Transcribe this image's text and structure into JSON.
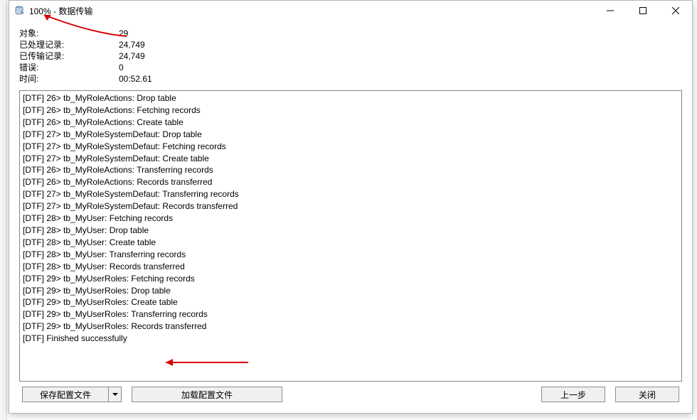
{
  "window": {
    "title": "100% - 数据传输"
  },
  "stats": {
    "objects_label": "对象:",
    "objects_value": "29",
    "processed_label": "已处理记录:",
    "processed_value": "24,749",
    "transferred_label": "已传输记录:",
    "transferred_value": "24,749",
    "errors_label": "错误:",
    "errors_value": "0",
    "time_label": "时间:",
    "time_value": "00:52.61"
  },
  "log": [
    "[DTF] 26> tb_MyRoleActions: Drop table",
    "[DTF] 26> tb_MyRoleActions: Fetching records",
    "[DTF] 26> tb_MyRoleActions: Create table",
    "[DTF] 27> tb_MyRoleSystemDefaut: Drop table",
    "[DTF] 27> tb_MyRoleSystemDefaut: Fetching records",
    "[DTF] 27> tb_MyRoleSystemDefaut: Create table",
    "[DTF] 26> tb_MyRoleActions: Transferring records",
    "[DTF] 26> tb_MyRoleActions: Records transferred",
    "[DTF] 27> tb_MyRoleSystemDefaut: Transferring records",
    "[DTF] 27> tb_MyRoleSystemDefaut: Records transferred",
    "[DTF] 28> tb_MyUser: Fetching records",
    "[DTF] 28> tb_MyUser: Drop table",
    "[DTF] 28> tb_MyUser: Create table",
    "[DTF] 28> tb_MyUser: Transferring records",
    "[DTF] 28> tb_MyUser: Records transferred",
    "[DTF] 29> tb_MyUserRoles: Fetching records",
    "[DTF] 29> tb_MyUserRoles: Drop table",
    "[DTF] 29> tb_MyUserRoles: Create table",
    "[DTF] 29> tb_MyUserRoles: Transferring records",
    "[DTF] 29> tb_MyUserRoles: Records transferred",
    "[DTF] Finished successfully"
  ],
  "buttons": {
    "save": "保存配置文件",
    "load": "加载配置文件",
    "prev": "上一步",
    "close": "关闭"
  }
}
